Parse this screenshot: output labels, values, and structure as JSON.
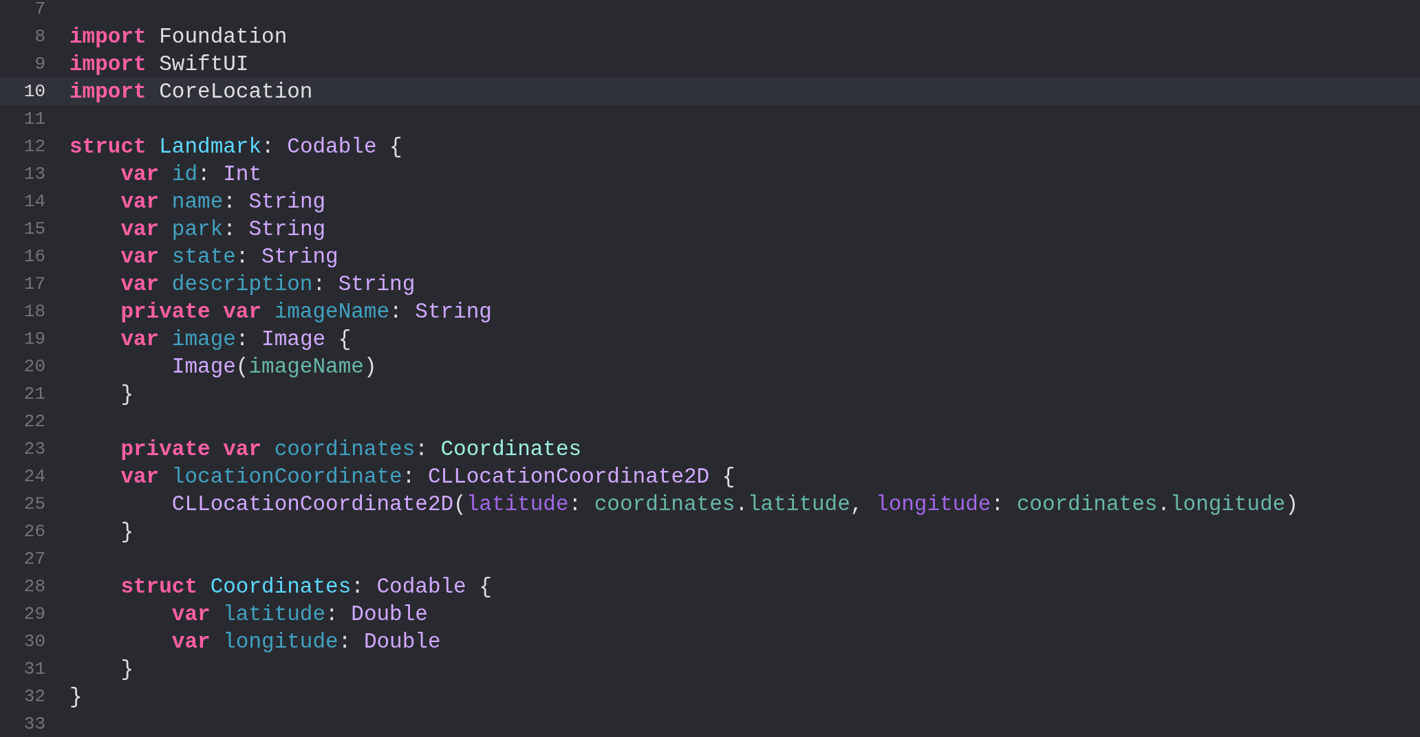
{
  "editor": {
    "lines": [
      {
        "number": "7",
        "current": false
      },
      {
        "number": "8",
        "current": false,
        "tokens": [
          {
            "text": "import",
            "kind": "keyword"
          },
          {
            "text": " Foundation",
            "kind": "plain"
          }
        ]
      },
      {
        "number": "9",
        "current": false,
        "tokens": [
          {
            "text": "import",
            "kind": "keyword"
          },
          {
            "text": " SwiftUI",
            "kind": "plain"
          }
        ]
      },
      {
        "number": "10",
        "current": true,
        "tokens": [
          {
            "text": "import",
            "kind": "keyword"
          },
          {
            "text": " CoreLocation",
            "kind": "plain"
          }
        ]
      },
      {
        "number": "11",
        "current": false
      },
      {
        "number": "12",
        "current": false,
        "tokens": [
          {
            "text": "struct",
            "kind": "keyword"
          },
          {
            "text": " Landmark",
            "kind": "type_decl"
          },
          {
            "text": ": ",
            "kind": "plain"
          },
          {
            "text": "Codable",
            "kind": "type"
          },
          {
            "text": " {",
            "kind": "plain"
          }
        ]
      },
      {
        "number": "13",
        "current": false,
        "tokens": [
          {
            "text": "    var",
            "kind": "keyword"
          },
          {
            "text": " id",
            "kind": "prop_decl"
          },
          {
            "text": ": ",
            "kind": "plain"
          },
          {
            "text": "Int",
            "kind": "type"
          }
        ]
      },
      {
        "number": "14",
        "current": false,
        "tokens": [
          {
            "text": "    var",
            "kind": "keyword"
          },
          {
            "text": " name",
            "kind": "prop_decl"
          },
          {
            "text": ": ",
            "kind": "plain"
          },
          {
            "text": "String",
            "kind": "type"
          }
        ]
      },
      {
        "number": "15",
        "current": false,
        "tokens": [
          {
            "text": "    var",
            "kind": "keyword"
          },
          {
            "text": " park",
            "kind": "prop_decl"
          },
          {
            "text": ": ",
            "kind": "plain"
          },
          {
            "text": "String",
            "kind": "type"
          }
        ]
      },
      {
        "number": "16",
        "current": false,
        "tokens": [
          {
            "text": "    var",
            "kind": "keyword"
          },
          {
            "text": " state",
            "kind": "prop_decl"
          },
          {
            "text": ": ",
            "kind": "plain"
          },
          {
            "text": "String",
            "kind": "type"
          }
        ]
      },
      {
        "number": "17",
        "current": false,
        "tokens": [
          {
            "text": "    var",
            "kind": "keyword"
          },
          {
            "text": " description",
            "kind": "prop_decl"
          },
          {
            "text": ": ",
            "kind": "plain"
          },
          {
            "text": "String",
            "kind": "type"
          }
        ]
      },
      {
        "number": "18",
        "current": false,
        "tokens": [
          {
            "text": "    private var",
            "kind": "keyword"
          },
          {
            "text": " imageName",
            "kind": "prop_decl"
          },
          {
            "text": ": ",
            "kind": "plain"
          },
          {
            "text": "String",
            "kind": "type"
          }
        ]
      },
      {
        "number": "19",
        "current": false,
        "tokens": [
          {
            "text": "    var",
            "kind": "keyword"
          },
          {
            "text": " image",
            "kind": "prop_decl"
          },
          {
            "text": ": ",
            "kind": "plain"
          },
          {
            "text": "Image",
            "kind": "type"
          },
          {
            "text": " {",
            "kind": "plain"
          }
        ]
      },
      {
        "number": "20",
        "current": false,
        "tokens": [
          {
            "text": "        Image",
            "kind": "type"
          },
          {
            "text": "(",
            "kind": "plain"
          },
          {
            "text": "imageName",
            "kind": "ref"
          },
          {
            "text": ")",
            "kind": "plain"
          }
        ]
      },
      {
        "number": "21",
        "current": false,
        "tokens": [
          {
            "text": "    }",
            "kind": "plain"
          }
        ]
      },
      {
        "number": "22",
        "current": false
      },
      {
        "number": "23",
        "current": false,
        "tokens": [
          {
            "text": "    private var",
            "kind": "keyword"
          },
          {
            "text": " coordinates",
            "kind": "prop_decl"
          },
          {
            "text": ": ",
            "kind": "plain"
          },
          {
            "text": "Coordinates",
            "kind": "project_type"
          }
        ]
      },
      {
        "number": "24",
        "current": false,
        "tokens": [
          {
            "text": "    var",
            "kind": "keyword"
          },
          {
            "text": " locationCoordinate",
            "kind": "prop_decl"
          },
          {
            "text": ": ",
            "kind": "plain"
          },
          {
            "text": "CLLocationCoordinate2D",
            "kind": "type"
          },
          {
            "text": " {",
            "kind": "plain"
          }
        ]
      },
      {
        "number": "25",
        "current": false,
        "tokens": [
          {
            "text": "        CLLocationCoordinate2D",
            "kind": "type"
          },
          {
            "text": "(",
            "kind": "plain"
          },
          {
            "text": "latitude",
            "kind": "label"
          },
          {
            "text": ": ",
            "kind": "plain"
          },
          {
            "text": "coordinates",
            "kind": "ref"
          },
          {
            "text": ".",
            "kind": "plain"
          },
          {
            "text": "latitude",
            "kind": "ref"
          },
          {
            "text": ", ",
            "kind": "plain"
          },
          {
            "text": "longitude",
            "kind": "label"
          },
          {
            "text": ": ",
            "kind": "plain"
          },
          {
            "text": "coordinates",
            "kind": "ref"
          },
          {
            "text": ".",
            "kind": "plain"
          },
          {
            "text": "longitude",
            "kind": "ref"
          },
          {
            "text": ")",
            "kind": "plain"
          }
        ]
      },
      {
        "number": "26",
        "current": false,
        "tokens": [
          {
            "text": "    }",
            "kind": "plain"
          }
        ]
      },
      {
        "number": "27",
        "current": false
      },
      {
        "number": "28",
        "current": false,
        "tokens": [
          {
            "text": "    struct",
            "kind": "keyword"
          },
          {
            "text": " Coordinates",
            "kind": "type_decl"
          },
          {
            "text": ": ",
            "kind": "plain"
          },
          {
            "text": "Codable",
            "kind": "type"
          },
          {
            "text": " {",
            "kind": "plain"
          }
        ]
      },
      {
        "number": "29",
        "current": false,
        "tokens": [
          {
            "text": "        var",
            "kind": "keyword"
          },
          {
            "text": " latitude",
            "kind": "prop_decl"
          },
          {
            "text": ": ",
            "kind": "plain"
          },
          {
            "text": "Double",
            "kind": "type"
          }
        ]
      },
      {
        "number": "30",
        "current": false,
        "tokens": [
          {
            "text": "        var",
            "kind": "keyword"
          },
          {
            "text": " longitude",
            "kind": "prop_decl"
          },
          {
            "text": ": ",
            "kind": "plain"
          },
          {
            "text": "Double",
            "kind": "type"
          }
        ]
      },
      {
        "number": "31",
        "current": false,
        "tokens": [
          {
            "text": "    }",
            "kind": "plain"
          }
        ]
      },
      {
        "number": "32",
        "current": false,
        "tokens": [
          {
            "text": "}",
            "kind": "plain"
          }
        ]
      },
      {
        "number": "33",
        "current": false
      }
    ]
  }
}
